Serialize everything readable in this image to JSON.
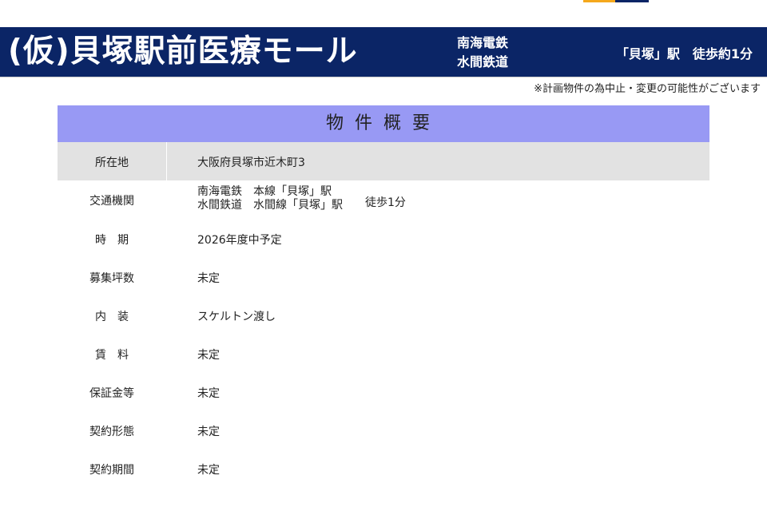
{
  "colors": {
    "banner_bg": "#0b2566",
    "header_bg": "#9899f4",
    "row_shade": "#e2e2e2",
    "accent_orange": "#f5a81c",
    "accent_navy": "#0b2566"
  },
  "banner": {
    "title": "(仮)貝塚駅前医療モール",
    "line1": "南海電鉄",
    "line2": "水間鉄道",
    "station": "「貝塚」駅",
    "walk": "徒歩約1分"
  },
  "notice": "※計画物件の為中止・変更の可能性がございます",
  "overview": {
    "title": "物件概要",
    "rows": [
      {
        "label": "所在地",
        "value": "大阪府貝塚市近木町3"
      },
      {
        "label": "交通機関",
        "value_line1": "南海電鉄　本線「貝塚」駅",
        "value_line2": "水間鉄道　水間線「貝塚」駅",
        "walk": "徒歩1分"
      },
      {
        "label": "時　期",
        "value": "2026年度中予定"
      },
      {
        "label": "募集坪数",
        "value": "未定"
      },
      {
        "label": "内　装",
        "value": "スケルトン渡し"
      },
      {
        "label": "賃　料",
        "value": "未定"
      },
      {
        "label": "保証金等",
        "value": "未定"
      },
      {
        "label": "契約形態",
        "value": "未定"
      },
      {
        "label": "契約期間",
        "value": "未定"
      }
    ]
  }
}
